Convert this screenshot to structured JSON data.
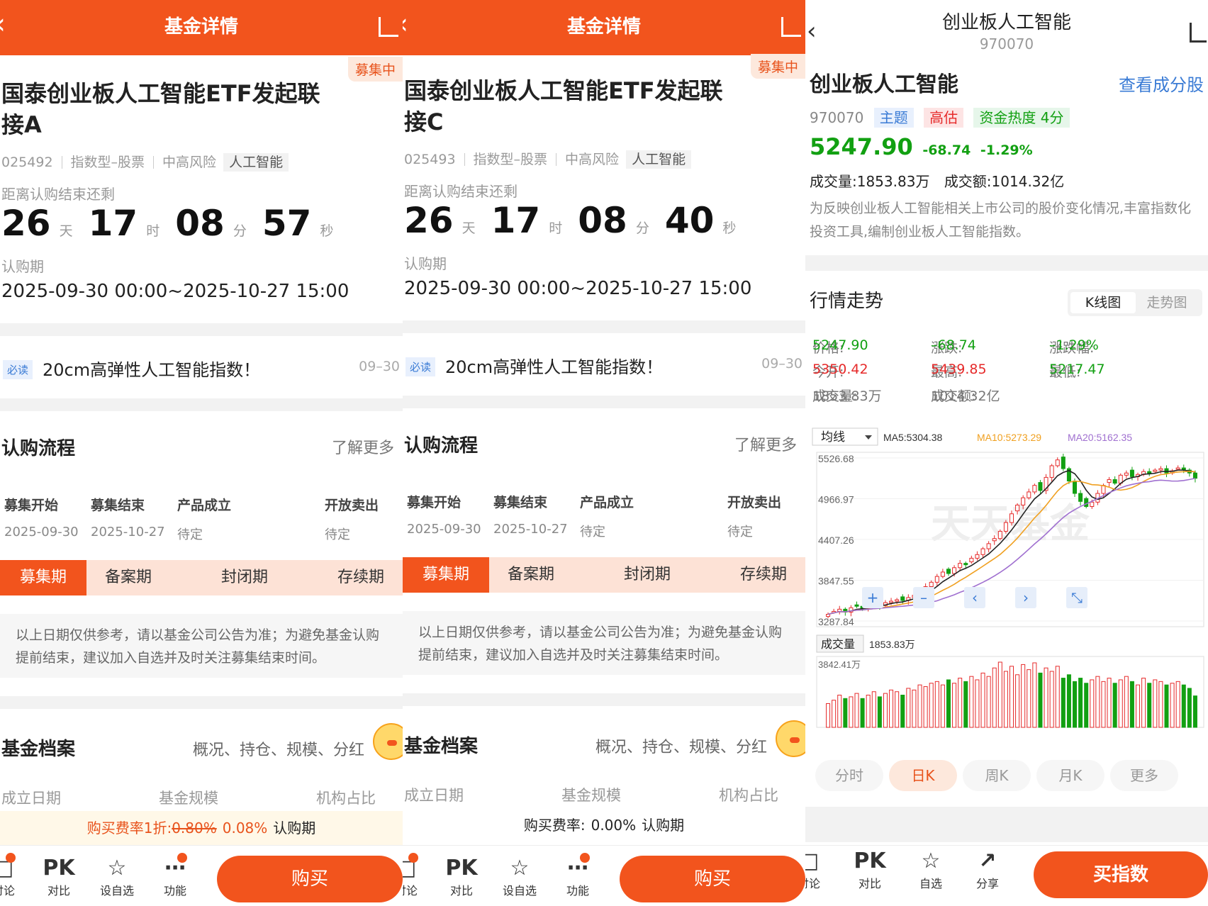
{
  "panels": [
    {
      "header": {
        "title": "基金详情"
      },
      "status": "募集中",
      "fund_name": "国泰创业板人工智能ETF发起联接A",
      "code": "025492",
      "type": "指数型–股票",
      "risk": "中高风险",
      "theme": "人工智能",
      "countdown_label": "距离认购结束还剩",
      "days": "26",
      "day_unit": "天",
      "hours": "17",
      "hour_unit": "时",
      "minutes": "08",
      "minute_unit": "分",
      "seconds": "57",
      "second_unit": "秒",
      "period_label": "认购期",
      "period": "2025-09-30 00:00~2025-10-27 15:00",
      "notice_tag": "必读",
      "notice": "20cm高弹性人工智能指数！",
      "notice_date": "09–30",
      "flow_title": "认购流程",
      "flow_more": "了解更多",
      "steps": [
        {
          "label": "募集开始",
          "date": "2025-09-30"
        },
        {
          "label": "募集结束",
          "date": "2025-10-27"
        },
        {
          "label": "产品成立",
          "date": "待定"
        },
        {
          "label": "开放卖出",
          "date": "待定"
        }
      ],
      "phases": [
        "募集期",
        "备案期",
        "封闭期",
        "存续期"
      ],
      "tip": "以上日期仅供参考，请以基金公司公告为准；为避免基金认购提前结束，建议加入自选并及时关注募集结束时间。",
      "archive_title": "基金档案",
      "archive_sub": "概况、持仓、规模、分红",
      "links": [
        "成立日期",
        "基金规模",
        "机构占比"
      ],
      "fee": {
        "label": "购买费率1折:",
        "old": "0.80%",
        "new": "0.08%",
        "suffix": "认购期"
      },
      "bottom": [
        "讨论",
        "对比",
        "设自选",
        "功能"
      ],
      "pk": "PK",
      "buy": "购买"
    },
    {
      "header": {
        "title": "基金详情"
      },
      "status": "募集中",
      "fund_name": "国泰创业板人工智能ETF发起联接C",
      "code": "025493",
      "type": "指数型–股票",
      "risk": "中高风险",
      "theme": "人工智能",
      "countdown_label": "距离认购结束还剩",
      "days": "26",
      "day_unit": "天",
      "hours": "17",
      "hour_unit": "时",
      "minutes": "08",
      "minute_unit": "分",
      "seconds": "40",
      "second_unit": "秒",
      "period_label": "认购期",
      "period": "2025-09-30 00:00~2025-10-27 15:00",
      "notice_tag": "必读",
      "notice": "20cm高弹性人工智能指数！",
      "notice_date": "09–30",
      "flow_title": "认购流程",
      "flow_more": "了解更多",
      "steps": [
        {
          "label": "募集开始",
          "date": "2025-09-30"
        },
        {
          "label": "募集结束",
          "date": "2025-10-27"
        },
        {
          "label": "产品成立",
          "date": "待定"
        },
        {
          "label": "开放卖出",
          "date": "待定"
        }
      ],
      "phases": [
        "募集期",
        "备案期",
        "封闭期",
        "存续期"
      ],
      "tip": "以上日期仅供参考，请以基金公司公告为准；为避免基金认购提前结束，建议加入自选并及时关注募集结束时间。",
      "archive_title": "基金档案",
      "archive_sub": "概况、持仓、规模、分红",
      "links": [
        "成立日期",
        "基金规模",
        "机构占比"
      ],
      "fee": {
        "label": "购买费率:",
        "old": "",
        "new": "0.00%",
        "suffix": "认购期"
      },
      "bottom": [
        "讨论",
        "对比",
        "设自选",
        "功能"
      ],
      "pk": "PK",
      "buy": "购买"
    }
  ],
  "index": {
    "title": "创业板人工智能",
    "code": "970070",
    "name": "创业板人工智能",
    "view_components": "查看成分股",
    "tags": [
      "主题",
      "高估",
      "资金热度 4分"
    ],
    "price": "5247.90",
    "change": "-68.74",
    "change_pct": "-1.29%",
    "volume_line": "成交量:1853.83万",
    "amount_line": "成交额:1014.32亿",
    "desc": "为反映创业板人工智能相关上市公司的股价变化情况,丰富指数化投资工具,编制创业板人工智能指数。",
    "trend_title": "行情走势",
    "toggle": [
      "K线图",
      "走势图"
    ],
    "quotes": [
      {
        "k": "价格:",
        "v": "5247.90",
        "c": "g"
      },
      {
        "k": "涨跌:",
        "v": "–68.74",
        "c": "g"
      },
      {
        "k": "涨跌幅:",
        "v": "–1.29%",
        "c": "g"
      },
      {
        "k": "今开:",
        "v": "5350.42",
        "c": "r"
      },
      {
        "k": "最高:",
        "v": "5439.85",
        "c": "r"
      },
      {
        "k": "最低:",
        "v": "5217.47",
        "c": "g"
      },
      {
        "k": "成交量:",
        "v": "1853.83万",
        "c": ""
      },
      {
        "k": "成交额:",
        "v": "1014.32亿",
        "c": ""
      }
    ],
    "timeframes": [
      "分时",
      "日K",
      "周K",
      "月K",
      "更多"
    ],
    "bottom": [
      "讨论",
      "对比",
      "自选",
      "分享"
    ],
    "pk": "PK",
    "buy": "买指数"
  },
  "chart_data": {
    "type": "candlestick",
    "ma_selector": "均线",
    "ma_labels": [
      "MA5:5304.38",
      "MA10:5273.29",
      "MA20:5162.35"
    ],
    "y_ticks": [
      "5526.68",
      "4966.97",
      "4407.26",
      "3847.55",
      "3287.84"
    ],
    "ylim": [
      3287.84,
      5526.68
    ],
    "volume_label": "成交量",
    "volume_value": "1853.83万",
    "volume_max_label": "3842.41万",
    "volume_max": 3842.41,
    "x_start": "2025-07-23",
    "x_end": "2025-09-30",
    "watermark": "天天基金",
    "colors": {
      "up": "#e62a2a",
      "down": "#12a012",
      "ma5": "#222222",
      "ma10": "#f0a020",
      "ma20": "#a070d0"
    },
    "closes": [
      3380,
      3420,
      3450,
      3410,
      3470,
      3490,
      3460,
      3510,
      3530,
      3500,
      3540,
      3560,
      3580,
      3570,
      3610,
      3640,
      3700,
      3760,
      3820,
      3900,
      3960,
      3940,
      4020,
      4080,
      4060,
      4150,
      4200,
      4280,
      4350,
      4420,
      4520,
      4640,
      4760,
      4880,
      4980,
      5060,
      5150,
      5080,
      5260,
      5420,
      5500,
      5380,
      5210,
      5040,
      4930,
      4860,
      4920,
      5040,
      5150,
      5230,
      5180,
      5290,
      5320,
      5270,
      5300,
      5340,
      5310,
      5360,
      5380,
      5320,
      5350,
      5390,
      5360,
      5320,
      5247.9
    ],
    "volumes": [
      1400,
      1600,
      1900,
      1700,
      1800,
      2000,
      1700,
      1900,
      2100,
      1800,
      2000,
      2200,
      2100,
      1900,
      2300,
      2200,
      2500,
      2400,
      2600,
      2700,
      2500,
      2800,
      2600,
      2900,
      2700,
      3000,
      2800,
      3200,
      3000,
      3500,
      3842,
      3300,
      3600,
      3100,
      3700,
      3400,
      3800,
      3200,
      3500,
      3300,
      3600,
      2900,
      3100,
      2700,
      2900,
      2600,
      2800,
      3000,
      2700,
      2900,
      2600,
      2800,
      3000,
      2700,
      2500,
      2900,
      2600,
      2800,
      2700,
      2500,
      2600,
      2700,
      2500,
      2300,
      1853
    ]
  }
}
